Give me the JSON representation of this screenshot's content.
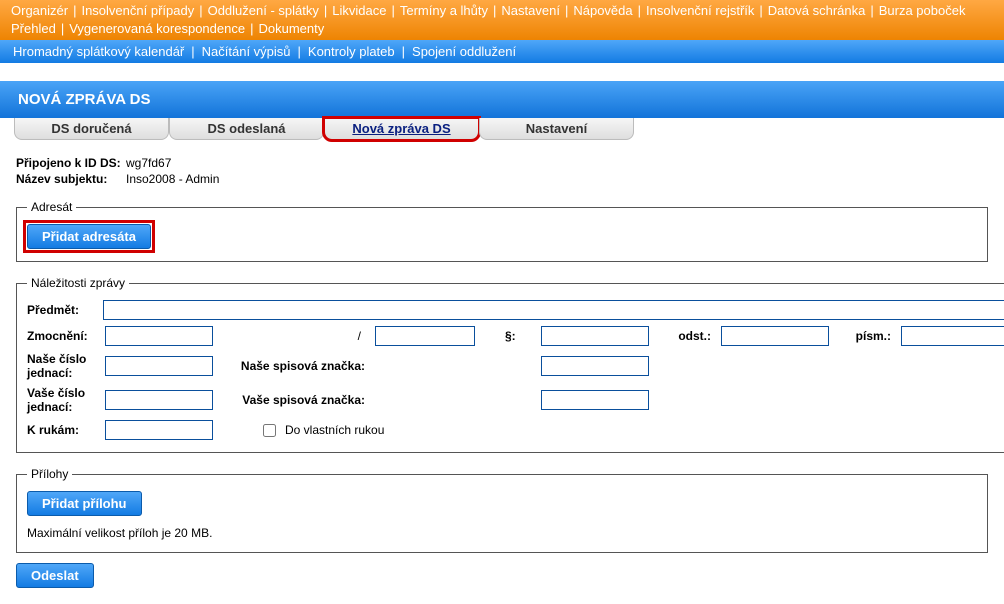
{
  "topnav": {
    "row1": [
      "Organizér",
      "Insolvenční případy",
      "Oddlužení - splátky",
      "Likvidace",
      "Termíny a lhůty",
      "Nastavení",
      "Nápověda",
      "Insolvenční rejstřík",
      "Datová schránka",
      "Burza poboček"
    ],
    "row2": [
      "Přehled",
      "Vygenerovaná korespondence",
      "Dokumenty"
    ]
  },
  "subnav": [
    "Hromadný splátkový kalendář",
    "Načítání výpisů",
    "Kontroly plateb",
    "Spojení oddlužení"
  ],
  "page_title": "NOVÁ ZPRÁVA DS",
  "tabs": [
    {
      "label": "DS doručená",
      "active": false
    },
    {
      "label": "DS odeslaná",
      "active": false
    },
    {
      "label": "Nová zpráva DS",
      "active": true
    },
    {
      "label": "Nastavení",
      "active": false
    }
  ],
  "connection": {
    "id_label": "Připojeno k ID DS:",
    "id_value": "wg7fd67",
    "subject_label": "Název subjektu:",
    "subject_value": "Inso2008 - Admin"
  },
  "adresat": {
    "legend": "Adresát",
    "button": "Přidat adresáta"
  },
  "nalezitosti": {
    "legend": "Náležitosti zprávy",
    "predmet_label": "Předmět:",
    "predmet_value": "",
    "zmocneni_label": "Zmocnění:",
    "zmocneni1": "",
    "zmocneni2": "",
    "par_label": "§:",
    "par_value": "",
    "odst_label": "odst.:",
    "odst_value": "",
    "pism_label": "písm.:",
    "pism_value": "",
    "nase_cislo_label": "Naše číslo jednací:",
    "nase_cislo_value": "",
    "nase_spis_label": "Naše spisová značka:",
    "nase_spis_value": "",
    "vase_cislo_label": "Vaše číslo jednací:",
    "vase_cislo_value": "",
    "vase_spis_label": "Vaše spisová značka:",
    "vase_spis_value": "",
    "krukam_label": "K rukám:",
    "krukam_value": "",
    "dovlast_label": "Do vlastních rukou"
  },
  "prilohy": {
    "legend": "Přílohy",
    "button": "Přidat přílohu",
    "note": "Maximální velikost příloh je 20 MB."
  },
  "send_label": "Odeslat"
}
